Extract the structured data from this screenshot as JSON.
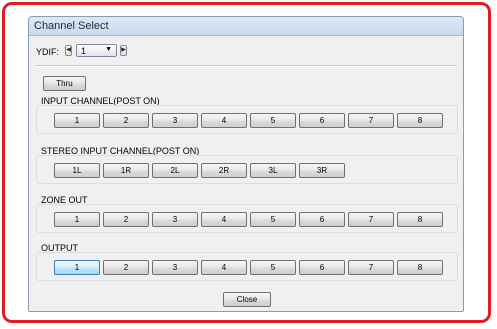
{
  "window": {
    "title": "Channel Select"
  },
  "ydif": {
    "label": "YDIF:",
    "value": "1",
    "prev_icon": "triangle-left",
    "next_icon": "triangle-right",
    "dropdown_icon": "triangle-down"
  },
  "thru_label": "Thru",
  "input_channel": {
    "label": "INPUT CHANNEL(POST ON)",
    "buttons": [
      "1",
      "2",
      "3",
      "4",
      "5",
      "6",
      "7",
      "8"
    ]
  },
  "stereo_input_channel": {
    "label": "STEREO INPUT CHANNEL(POST ON)",
    "buttons": [
      "1L",
      "1R",
      "2L",
      "2R",
      "3L",
      "3R"
    ]
  },
  "zone_out": {
    "label": "ZONE OUT",
    "buttons": [
      "1",
      "2",
      "3",
      "4",
      "5",
      "6",
      "7",
      "8"
    ]
  },
  "output": {
    "label": "OUTPUT",
    "buttons": [
      "1",
      "2",
      "3",
      "4",
      "5",
      "6",
      "7",
      "8"
    ],
    "selected": "1"
  },
  "close_label": "Close",
  "colors": {
    "annotation_border": "#e21b23",
    "selected_button": "#bee6fd"
  }
}
